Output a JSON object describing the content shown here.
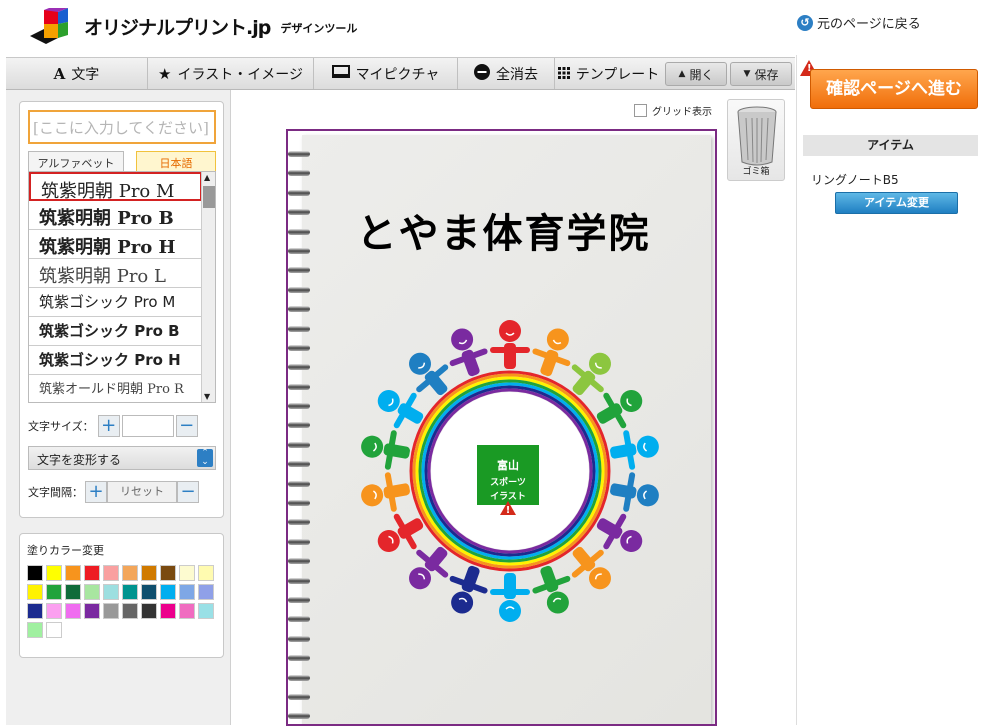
{
  "header": {
    "logo_name": "オリジナルプリント.jp",
    "logo_sub": "デザインツール",
    "back_link": "元のページに戻る"
  },
  "toolbar": {
    "text": "文字",
    "illust": "イラスト・イメージ",
    "mypic": "マイピクチャ",
    "clear": "全消去",
    "template": "テンプレート",
    "open": "開く",
    "save": "保存"
  },
  "text_panel": {
    "placeholder": "[ここに入力してください]",
    "tab_alphabet": "アルファベット",
    "tab_japanese": "日本語",
    "fonts": [
      "筑紫明朝 Pro M",
      "筑紫明朝 Pro B",
      "筑紫明朝 Pro H",
      "筑紫明朝 Pro L",
      "筑紫ゴシック Pro M",
      "筑紫ゴシック Pro B",
      "筑紫ゴシック Pro H",
      "筑紫オールド明朝 Pro R"
    ],
    "selected_font_index": 0,
    "size_label": "文字サイズ：",
    "transform_label": "文字を変形する",
    "spacing_label": "文字間隔：",
    "reset_label": "リセット"
  },
  "color_panel": {
    "title": "塗りカラー変更",
    "swatches": [
      "#000000",
      "#ffff00",
      "#f7941d",
      "#ee1c24",
      "#f9a0a0",
      "#f3a65a",
      "#d07a00",
      "#7a4a10",
      "#fdfbd0",
      "#fffbb0",
      "#fff200",
      "#21a33b",
      "#0f6b3a",
      "#a8e6a0",
      "#9ddfe0",
      "#00948f",
      "#0f4f6e",
      "#00aeef",
      "#7ea7e6",
      "#8fa0e8",
      "#1c2b8f",
      "#fba0f0",
      "#f06cf0",
      "#7a2aa0",
      "#999999",
      "#666666",
      "#333333",
      "#ec008c",
      "#f06cc0",
      "#99e0e6",
      "#a0f0a0",
      "#ffffff"
    ]
  },
  "canvas": {
    "grid_label": "グリッド表示",
    "trash_label": "ゴミ箱",
    "title": "とやま体育学院",
    "stamp_text": "富山スポーツイラスト"
  },
  "rightbar": {
    "confirm": "確認ページへ進む",
    "item_head": "アイテム",
    "item_name": "リングノートB5",
    "item_change": "アイテム変更"
  }
}
